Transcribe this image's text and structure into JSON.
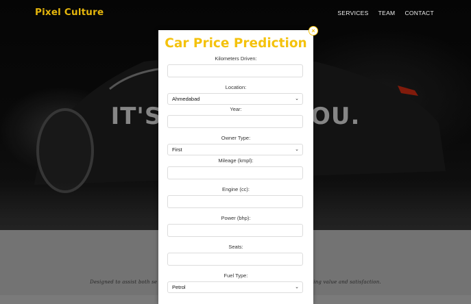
{
  "nav": {
    "logo": "Pixel Culture",
    "links": [
      "SERVICES",
      "TEAM",
      "CONTACT"
    ]
  },
  "hero": {
    "text_left": "IT'S N",
    "text_right": "YOU."
  },
  "lower": {
    "tagline_left": "Designed to assist both se",
    "tagline_right": "ing value and satisfaction."
  },
  "modal": {
    "title": "Car Price Prediction",
    "close_symbol": "×",
    "fields": {
      "kilometers_label": "Kilometers Driven:",
      "location_label": "Location:",
      "location_value": "Ahmedabad",
      "year_label": "Year:",
      "owner_label": "Owner Type:",
      "owner_value": "First",
      "mileage_label": "Mileage (kmpl):",
      "engine_label": "Engine (cc):",
      "power_label": "Power (bhp):",
      "seats_label": "Seats:",
      "fuel_label": "Fuel Type:",
      "fuel_value": "Petrol"
    }
  },
  "colors": {
    "accent": "#f4c20d",
    "hero_bg": "#0b0b0b",
    "lower_bg": "#7b7b7b"
  }
}
